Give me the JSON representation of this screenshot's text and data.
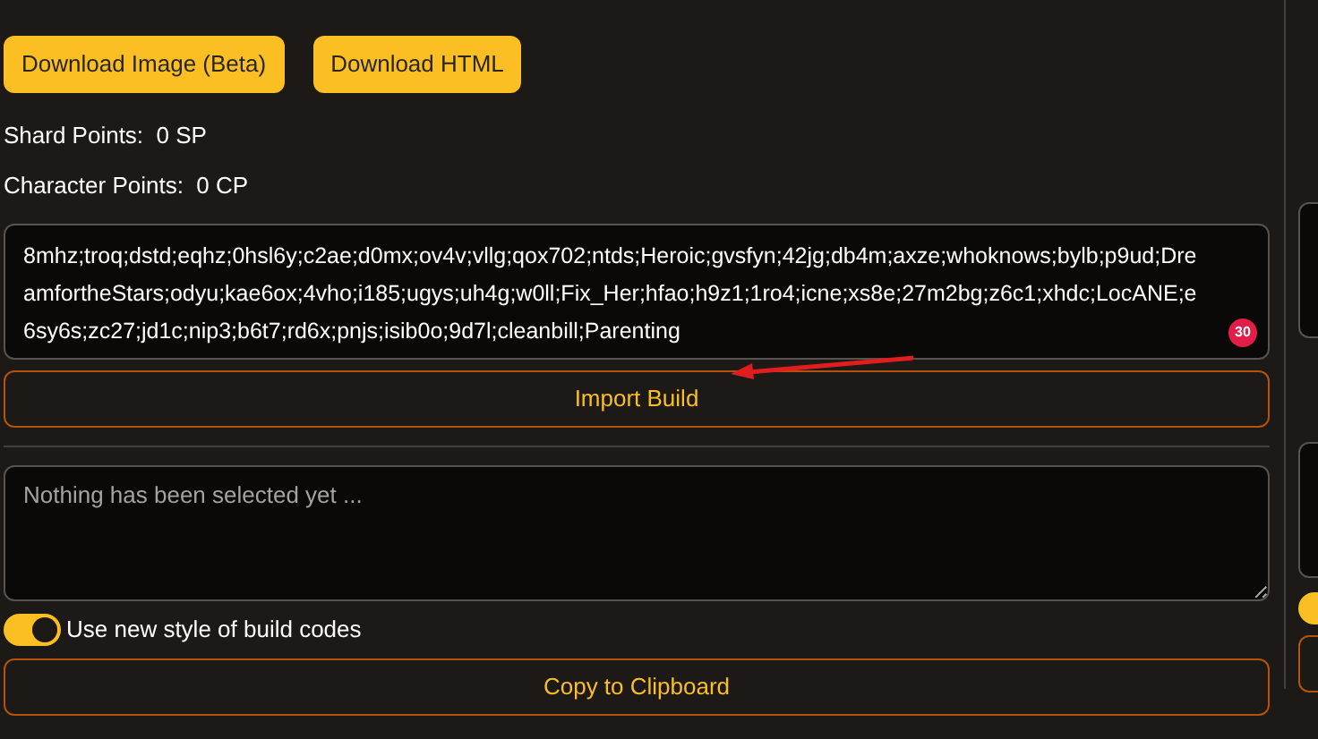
{
  "downloads": [
    {
      "label": "Download Image (Beta)"
    },
    {
      "label": "Download HTML"
    }
  ],
  "points": [
    {
      "label": "Shard Points:",
      "value": "0 SP"
    },
    {
      "label": "Character Points:",
      "value": "0 CP"
    }
  ],
  "import": {
    "code": "8mhz;troq;dstd;eqhz;0hsl6y;c2ae;d0mx;ov4v;vllg;qox702;ntds;Heroic;gvsfyn;42jg;db4m;axze;whoknows;bylb;p9ud;DreamfortheStars;odyu;kae6ox;4vho;i185;ugys;uh4g;w0ll;Fix_Her;hfao;h9z1;1ro4;icne;xs8e;27m2bg;z6c1;xhdc;LocANE;e6sy6s;zc27;jd1c;nip3;b6t7;rd6x;pnjs;isib0o;9d7l;cleanbill;Parenting",
    "badge": "30",
    "button": "Import Build",
    "annotation_arrow": true
  },
  "export": {
    "placeholder": "Nothing has been selected yet ...",
    "toggle": {
      "label": "Use new style of build codes",
      "on": true
    },
    "button": "Copy to Clipboard"
  },
  "side_panel": {
    "toggle": {
      "on": true
    }
  }
}
